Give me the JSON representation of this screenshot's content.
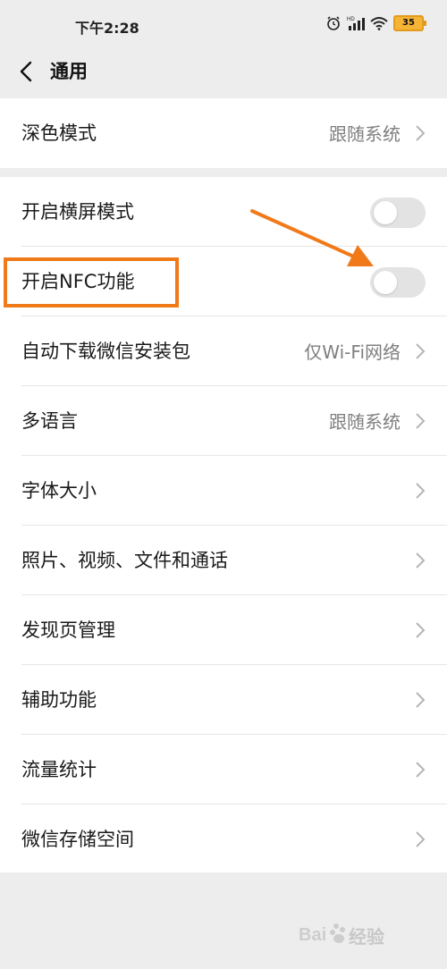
{
  "status_bar": {
    "time": "下午2:28",
    "battery": "35",
    "icons": [
      "alarm-icon",
      "signal-icon",
      "wifi-icon",
      "battery-icon"
    ]
  },
  "nav": {
    "title": "通用",
    "back_icon": "chevron-left-icon"
  },
  "group1": [
    {
      "label": "深色模式",
      "value": "跟随系统"
    }
  ],
  "group2": [
    {
      "label": "开启横屏模式",
      "toggle": false
    },
    {
      "label": "开启NFC功能",
      "toggle": false
    },
    {
      "label": "自动下载微信安装包",
      "value": "仅Wi-Fi网络"
    },
    {
      "label": "多语言",
      "value": "跟随系统"
    },
    {
      "label": "字体大小"
    },
    {
      "label": "照片、视频、文件和通话"
    },
    {
      "label": "发现页管理"
    },
    {
      "label": "辅助功能"
    },
    {
      "label": "流量统计"
    },
    {
      "label": "微信存储空间"
    }
  ],
  "annotation": {
    "color": "#f07a1a"
  },
  "watermark": {
    "text": "经验"
  }
}
